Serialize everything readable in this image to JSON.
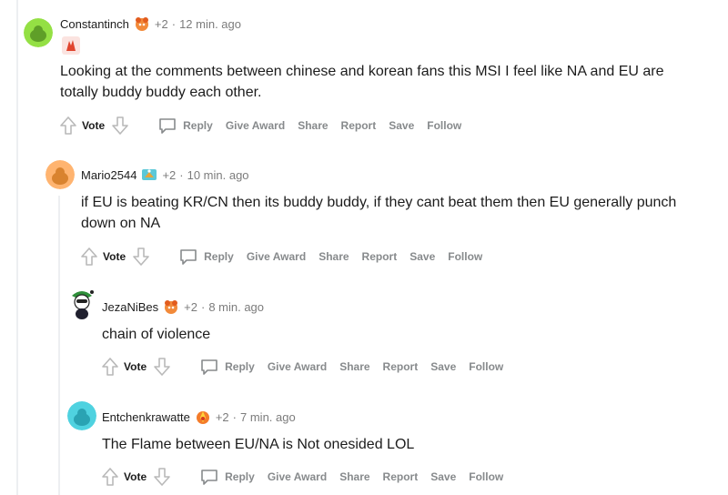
{
  "comments": [
    {
      "author": "Constantinch",
      "karma": "+2",
      "separator": "·",
      "time": "12 min. ago",
      "body": "Looking at the comments between chinese and korean fans this MSI I feel like NA and EU are totally buddy buddy each other.",
      "vote_label": "Vote",
      "actions": [
        "Reply",
        "Give Award",
        "Share",
        "Report",
        "Save",
        "Follow"
      ]
    },
    {
      "author": "Mario2544",
      "karma": "+2",
      "separator": "·",
      "time": "10 min. ago",
      "body": "if EU is beating KR/CN then its buddy buddy, if they cant beat them then EU generally punch down on NA",
      "vote_label": "Vote",
      "actions": [
        "Reply",
        "Give Award",
        "Share",
        "Report",
        "Save",
        "Follow"
      ]
    },
    {
      "author": "JezaNiBes",
      "karma": "+2",
      "separator": "·",
      "time": "8 min. ago",
      "body": "chain of violence",
      "vote_label": "Vote",
      "actions": [
        "Reply",
        "Give Award",
        "Share",
        "Report",
        "Save",
        "Follow"
      ]
    },
    {
      "author": "Entchenkrawatte",
      "karma": "+2",
      "separator": "·",
      "time": "7 min. ago",
      "body": "The Flame between EU/NA is Not onesided LOL",
      "vote_label": "Vote",
      "actions": [
        "Reply",
        "Give Award",
        "Share",
        "Report",
        "Save",
        "Follow"
      ]
    }
  ],
  "icons": {
    "upvote": "upvote-icon",
    "downvote": "downvote-icon",
    "reply": "reply-icon",
    "flair": "achievement-flair-icon"
  },
  "colors": {
    "meta_gray": "#7c7c7c",
    "action_gray": "#878a8c",
    "thread_line": "#edeff1"
  }
}
